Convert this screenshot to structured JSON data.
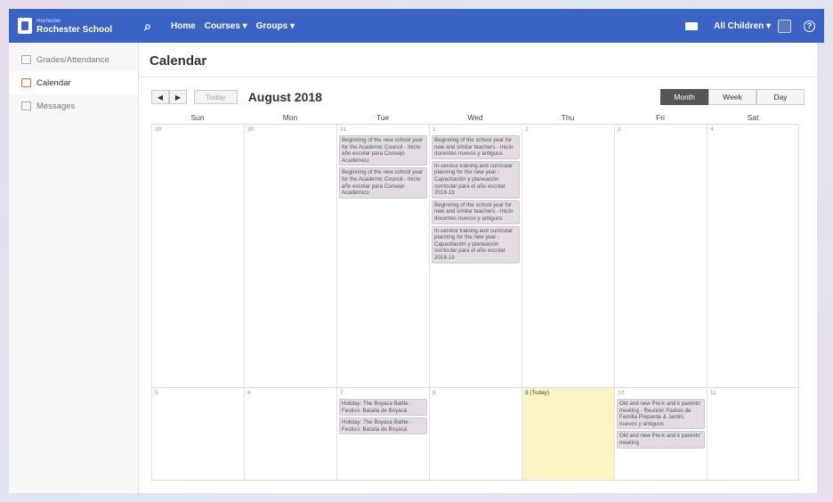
{
  "topbar": {
    "logo_small": "Rochester",
    "logo_big": "Rochester School",
    "nav": [
      "Home",
      "Courses ▾",
      "Groups ▾"
    ],
    "children_label": "All Children ▾",
    "help": "?"
  },
  "sidebar": {
    "items": [
      {
        "label": "Grades/Attendance",
        "icon": "grades-icon"
      },
      {
        "label": "Calendar",
        "icon": "calendar-icon"
      },
      {
        "label": "Messages",
        "icon": "messages-icon"
      }
    ]
  },
  "page": {
    "title": "Calendar"
  },
  "toolbar": {
    "prev": "◀",
    "next": "▶",
    "today": "Today",
    "month": "August 2018",
    "views": [
      "Month",
      "Week",
      "Day"
    ],
    "active_view": "Month"
  },
  "calendar": {
    "days_of_week": [
      "Sun",
      "Mon",
      "Tue",
      "Wed",
      "Thu",
      "Fri",
      "Sat"
    ],
    "week1": {
      "dates": [
        "29",
        "30",
        "31",
        "1",
        "2",
        "3",
        "4"
      ],
      "events": {
        "tue": [
          "Beginning of the new school year for the Academic Council - Inicio año escolar para Consejo Académico",
          "Beginning of the new school year for the Academic Council - Inicio año escolar para Consejo Académico"
        ],
        "wed": [
          "Beginning of the school year for new and similar teachers - Inicio docentes nuevos y antiguos",
          "In-service training and curricular planning for the new year - Capacitación y planeación curricular para el año escolar 2018-19",
          "Beginning of the school year for new and similar teachers - Inicio docentes nuevos y antiguos",
          "In-service training and curricular planning for the new year - Capacitación y planeación curricular para el año escolar 2018-19"
        ]
      }
    },
    "week2": {
      "dates": [
        "5",
        "6",
        "7",
        "8",
        "9 (Today)",
        "10",
        "11"
      ],
      "events": {
        "tue": [
          "Holiday: The Boyaca Battle - Festivo: Batalla de Boyacá",
          "Holiday: The Boyaca Battle - Festivo: Batalla de Boyacá"
        ],
        "fri": [
          "Old and new Pre-k and k parents' meeting - Reunión Padres de Familia Preparde & Jardín, nuevos y antiguos",
          "Old and new Pre-k and k parents' meeting"
        ]
      }
    }
  },
  "colors": {
    "topbar": "#3a63c6",
    "event_bg": "#e3dde3",
    "today_bg": "#fbf4c4",
    "active_view": "#555555"
  }
}
